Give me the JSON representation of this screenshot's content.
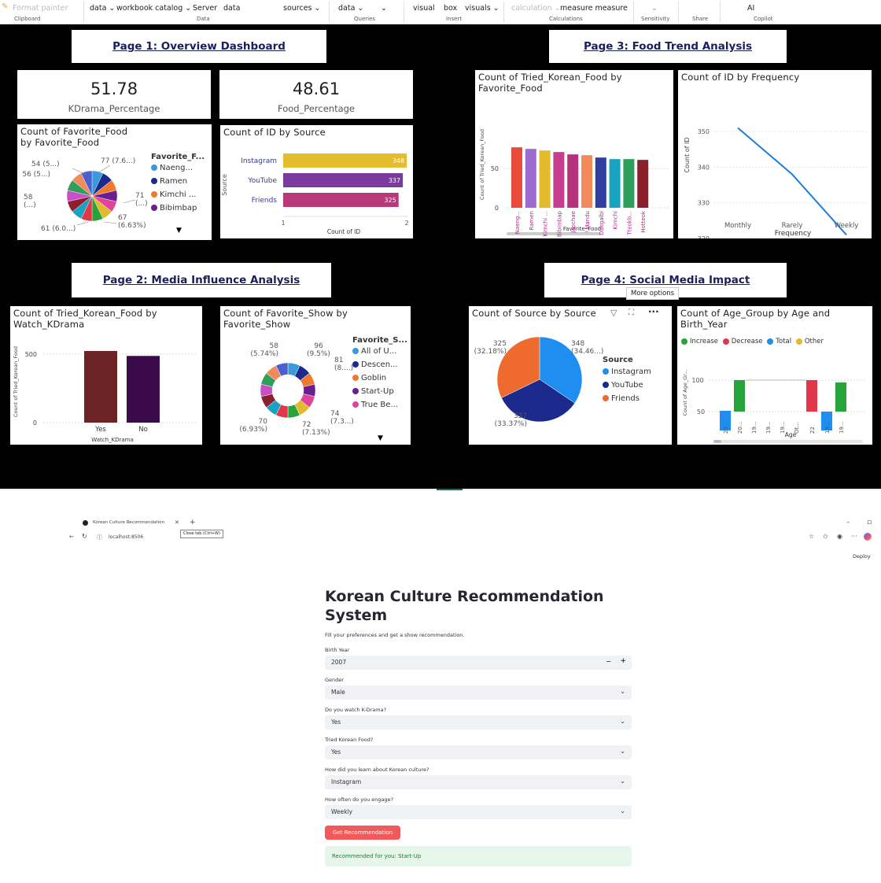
{
  "ribbon": {
    "format_painter": "Format painter",
    "clipboard": "Clipboard",
    "items": [
      "data ⌄",
      "workbook catalog ⌄",
      "Server",
      "data",
      "sources ⌄",
      "data ⌄",
      "⌄",
      "visual",
      "box",
      "visuals ⌄",
      "calculation ⌄",
      "measure measure",
      "⌄",
      "AI"
    ],
    "groups": [
      "Data",
      "Queries",
      "Insert",
      "Calculations",
      "Sensitivity",
      "Share",
      "Copilot"
    ]
  },
  "dashboard": {
    "headers": {
      "page1": "Page 1: Overview Dashboard",
      "page2": "Page 2: Media Influence Analysis",
      "page3": "Page 3: Food Trend Analysis",
      "page4": "Page 4: Social Media Impact"
    },
    "kpi_kdrama": {
      "value": "51.78",
      "label": "KDrama_Percentage"
    },
    "kpi_food": {
      "value": "48.61",
      "label": "Food_Percentage"
    },
    "fav_food_pie": {
      "title": "Count of Favorite_Food by Favorite_Food",
      "legend_title": "Favorite_F...",
      "legend": [
        "Naeng...",
        "Ramen",
        "Kimchi ...",
        "Bibimbap"
      ],
      "legend_colors": [
        "#3a9ad9",
        "#1b2a8c",
        "#ef7a2e",
        "#6a1d8f"
      ],
      "labels": [
        "54 (5...)",
        "56 (5...)",
        "58 (...)",
        "61 (6.0...)",
        "77 (7.6...)",
        "71 (...)",
        "67 (6.63%)"
      ]
    },
    "source_bar": {
      "title": "Count of ID by Source",
      "ylabel": "Source",
      "xlabel": "Count of ID",
      "ticks": [
        "1",
        "2"
      ]
    },
    "tried_food_bar": {
      "title": "Count of Tried_Korean_Food by Favorite_Food",
      "ylabel": "Count of Tried_Korean_Food",
      "xlabel": "Favorite_Food"
    },
    "freq_line": {
      "title": "Count of ID by Frequency",
      "ylabel": "Count of ID",
      "xlabel": "Frequency"
    },
    "kdrama_bar": {
      "title": "Count of Tried_Korean_Food by Watch_KDrama",
      "ylabel": "Count of Tried_Korean_Food",
      "xlabel": "Watch_KDrama"
    },
    "show_donut": {
      "title": "Count of Favorite_Show by Favorite_Show",
      "legend_title": "Favorite_S...",
      "legend": [
        "All of U...",
        "Descen...",
        "Goblin",
        "Start-Up",
        "True Be..."
      ],
      "legend_colors": [
        "#3a9ad9",
        "#1b2a8c",
        "#ef7a2e",
        "#6a1d8f",
        "#e0449a"
      ],
      "labels": [
        "58 (5.74%)",
        "96 (9.5%)",
        "81 (8....)",
        "74 (7.3...)",
        "72 (7.13%)",
        "70 (6.93%)"
      ]
    },
    "source_pie": {
      "title": "Count of Source by Source",
      "legend_title": "Source",
      "legend": [
        "Instagram",
        "YouTube",
        "Friends"
      ],
      "legend_colors": [
        "#1e8ef0",
        "#1b2a8c",
        "#ef6a2e"
      ],
      "labels": [
        "325 (32.18%)",
        "348 (34.46...)",
        "337 (33.37%)"
      ],
      "tooltip": "More options"
    },
    "age_waterfall": {
      "title": "Count of Age_Group by Age and Birth_Year",
      "legend": [
        "Increase",
        "Decrease",
        "Total",
        "Other"
      ],
      "legend_colors": [
        "#26a33a",
        "#e0384a",
        "#1e8ef0",
        "#e3b92d"
      ],
      "ylabel": "Count of Age_Gr...",
      "xlabel": "Age",
      "ticks": [
        "23",
        "20...",
        "19...",
        "19...",
        "19...",
        "Ot...",
        "22",
        "19...",
        "19..."
      ]
    }
  },
  "browser": {
    "tab_title": "Korean Culture Recommendation",
    "tooltip": "Close tab (Ctrl+W)",
    "url": "localhost:8506",
    "deploy": "Deploy"
  },
  "app": {
    "title_line1": "Korean Culture Recommendation",
    "title_line2": "System",
    "subtitle": "Fill your preferences and get a show recommendation.",
    "fields": [
      {
        "label": "Birth Year",
        "value": "2007"
      },
      {
        "label": "Gender",
        "value": "Male"
      },
      {
        "label": "Do you watch K-Drama?",
        "value": "Yes"
      },
      {
        "label": "Tried Korean Food?",
        "value": "Yes"
      },
      {
        "label": "How did you learn about Korean culture?",
        "value": "Instagram"
      },
      {
        "label": "How often do you engage?",
        "value": "Weekly"
      }
    ],
    "stepper": {
      "minus": "−",
      "plus": "+"
    },
    "button": "Get Recommendation",
    "result": "Recommended for you: Start-Up"
  },
  "chart_data": [
    {
      "type": "bar",
      "title": "Count of ID by Source",
      "orientation": "horizontal",
      "categories": [
        "Instagram",
        "YouTube",
        "Friends"
      ],
      "values": [
        348,
        337,
        325
      ],
      "colors": [
        "#e3bd2c",
        "#7b3a9e",
        "#b8397a"
      ],
      "xlabel": "Count of ID",
      "ylabel": "Source"
    },
    {
      "type": "bar",
      "title": "Count of Tried_Korean_Food by Favorite_Food",
      "categories": [
        "Naeng...",
        "Ramen",
        "Kimchi ...",
        "Bibimbap",
        "Japchae",
        "Mandu",
        "Dakgalbi",
        "Kimchi",
        "Tteokb...",
        "Hotteok"
      ],
      "values": [
        77,
        75,
        73,
        71,
        68,
        67,
        64,
        62,
        62,
        61
      ],
      "colors": [
        "#e84a3c",
        "#9b6bcf",
        "#e3b92d",
        "#c63d8f",
        "#b5337b",
        "#f28a5a",
        "#2f3f9e",
        "#19a3c2",
        "#2e9e5b",
        "#8a1f2e"
      ],
      "ylabel": "Count of Tried_Korean_Food",
      "xlabel": "Favorite_Food",
      "yticks": [
        0,
        50
      ]
    },
    {
      "type": "line",
      "title": "Count of ID by Frequency",
      "categories": [
        "Monthly",
        "Rarely",
        "Weekly"
      ],
      "values": [
        351,
        338,
        321
      ],
      "ylim": [
        320,
        350
      ],
      "yticks": [
        320,
        330,
        340,
        350
      ],
      "xlabel": "Frequency",
      "ylabel": "Count of ID"
    },
    {
      "type": "bar",
      "title": "Count of Tried_Korean_Food by Watch_KDrama",
      "categories": [
        "Yes",
        "No"
      ],
      "values": [
        523,
        487
      ],
      "colors": [
        "#6b2326",
        "#3b0a4a"
      ],
      "yticks": [
        0,
        500
      ],
      "xlabel": "Watch_KDrama",
      "ylabel": "Count of Tried_Korean_Food"
    }
  ]
}
